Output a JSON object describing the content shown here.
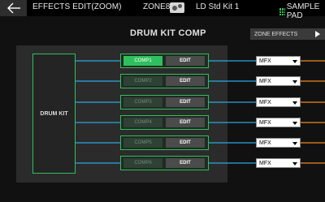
{
  "topbar": {
    "title": "EFFECTS EDIT(ZOOM)",
    "zone": "ZONE8",
    "kit_name": "LD Std Kit 1",
    "sample_pad": "SAMPLE PAD"
  },
  "header": {
    "title": "DRUM KIT COMP",
    "zone_effects_label": "ZONE EFFECTS"
  },
  "drum_kit_label": "DRUM KIT",
  "comps": [
    {
      "label": "COMP1",
      "edit": "EDIT",
      "active": true
    },
    {
      "label": "COMP2",
      "edit": "EDIT",
      "active": false
    },
    {
      "label": "COMP3",
      "edit": "EDIT",
      "active": false
    },
    {
      "label": "COMP4",
      "edit": "EDIT",
      "active": false
    },
    {
      "label": "COMP5",
      "edit": "EDIT",
      "active": false
    },
    {
      "label": "COMP6",
      "edit": "EDIT",
      "active": false
    }
  ],
  "outputs": [
    {
      "value": "MFX"
    },
    {
      "value": "MFX"
    },
    {
      "value": "MFX"
    },
    {
      "value": "MFX"
    },
    {
      "value": "MFX"
    },
    {
      "value": "MFX"
    }
  ],
  "colors": {
    "accent_green": "#2fbf5f",
    "wire_blue": "#2aa8e0",
    "wire_orange": "#f08a1c"
  }
}
